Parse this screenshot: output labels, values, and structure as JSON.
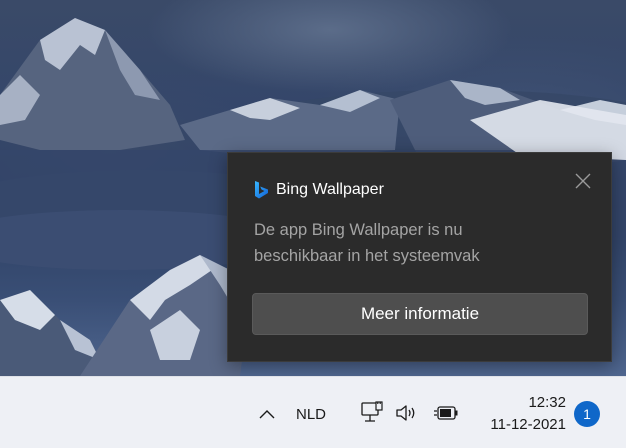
{
  "notification": {
    "app_icon": "bing-logo-icon",
    "app_name": "Bing Wallpaper",
    "message_line1": "De app Bing Wallpaper is nu",
    "message_line2": "beschikbaar in het systeemvak",
    "action_label": "Meer informatie",
    "close_icon": "close-icon"
  },
  "taskbar": {
    "overflow_icon": "chevron-up-icon",
    "language": "NLD",
    "network_icon": "ethernet-icon",
    "volume_icon": "speaker-icon",
    "battery_icon": "battery-charging-icon",
    "time": "12:32",
    "date": "11-12-2021",
    "notification_count": "1"
  },
  "colors": {
    "toast_background": "#2b2b2b",
    "button_background": "#4e4e4e",
    "taskbar_background": "#eef0f5",
    "badge_blue": "#0f67c9",
    "bing_blue": "#1e8ef0"
  }
}
